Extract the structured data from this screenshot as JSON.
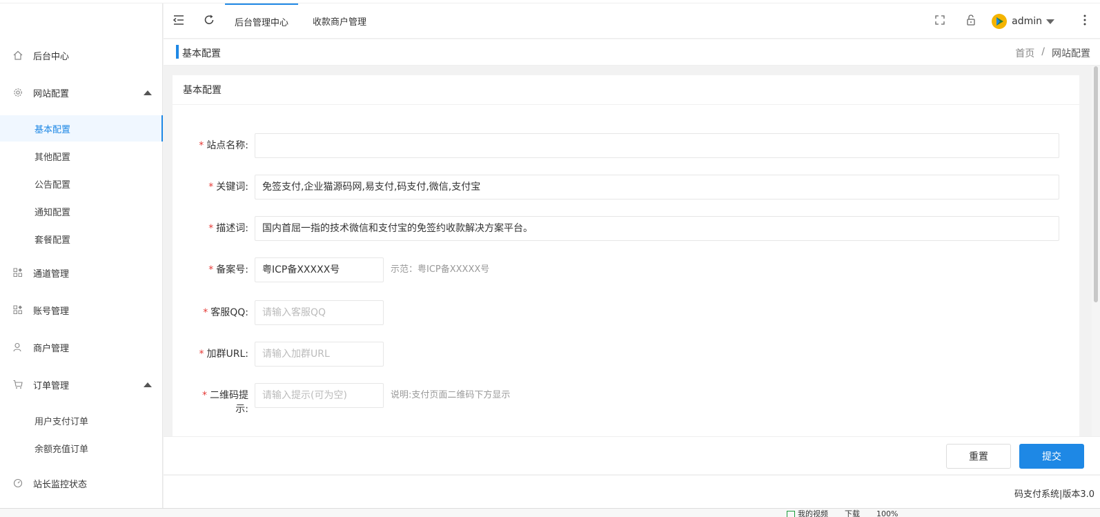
{
  "sidebar": {
    "items": [
      {
        "label": "后台中心",
        "icon": "home-icon"
      },
      {
        "label": "网站配置",
        "icon": "gear-icon",
        "expanded": true,
        "children": [
          {
            "label": "基本配置",
            "active": true
          },
          {
            "label": "其他配置"
          },
          {
            "label": "公告配置"
          },
          {
            "label": "通知配置"
          },
          {
            "label": "套餐配置"
          }
        ]
      },
      {
        "label": "通道管理",
        "icon": "grid-icon"
      },
      {
        "label": "账号管理",
        "icon": "grid-icon"
      },
      {
        "label": "商户管理",
        "icon": "user-icon"
      },
      {
        "label": "订单管理",
        "icon": "cart-icon",
        "expanded": true,
        "children": [
          {
            "label": "用户支付订单"
          },
          {
            "label": "余额充值订单"
          }
        ]
      },
      {
        "label": "站长监控状态",
        "icon": "gauge-icon"
      }
    ]
  },
  "header": {
    "tabs": [
      {
        "label": "后台管理中心",
        "active": true
      },
      {
        "label": "收款商户管理"
      }
    ],
    "user": {
      "name": "admin"
    }
  },
  "breadcrumb_bar": {
    "title": "基本配置",
    "crumbs": [
      "首页",
      "/",
      "网站配置"
    ]
  },
  "card": {
    "title": "基本配置",
    "fields": [
      {
        "label": "站点名称:",
        "value": "",
        "placeholder": "",
        "required": true
      },
      {
        "label": "关键词:",
        "value": "免签支付,企业猫源码网,易支付,码支付,微信,支付宝",
        "required": true
      },
      {
        "label": "描述词:",
        "value": "国内首屈一指的技术微信和支付宝的免签约收款解决方案平台。",
        "required": true
      },
      {
        "label": "备案号:",
        "value": "粤ICP备XXXXX号",
        "hint": "示范：粤ICP备XXXXX号",
        "required": true
      },
      {
        "label": "客服QQ:",
        "value": "",
        "placeholder": "请输入客服QQ",
        "required": true
      },
      {
        "label": "加群URL:",
        "value": "",
        "placeholder": "请输入加群URL",
        "required": true
      },
      {
        "label_line1": "二维码提",
        "label_line2": "示:",
        "value": "",
        "placeholder": "请输入提示(可为空)",
        "hint": "说明:支付页面二维码下方显示",
        "required": true
      }
    ]
  },
  "actions": {
    "reset": "重置",
    "submit": "提交"
  },
  "footer": {
    "version": "码支付系统|版本3.0"
  },
  "statusbar": {
    "items": [
      "我的视频",
      "下载",
      "100%"
    ]
  },
  "colors": {
    "accent": "#1e88e5",
    "required": "#e53935"
  }
}
